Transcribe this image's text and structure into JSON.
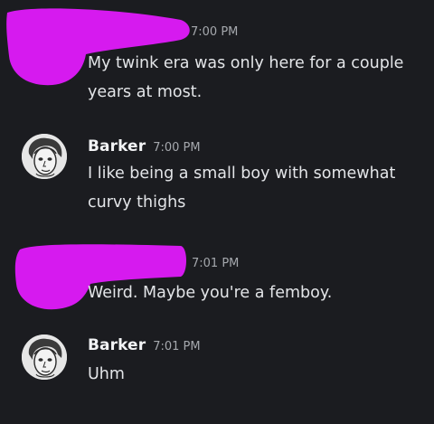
{
  "messages": [
    {
      "author": "",
      "timestamp": "7:00 PM",
      "text": "My twink era was only here for a couple years at most.",
      "redacted_author": true
    },
    {
      "author": "Barker",
      "timestamp": "7:00 PM",
      "text": "I like being a small boy with somewhat curvy thighs",
      "avatar": "cartoon-face-avatar"
    },
    {
      "author": "",
      "timestamp": "7:01 PM",
      "text": "Weird. Maybe you're a femboy.",
      "redacted_author": true
    },
    {
      "author": "Barker",
      "timestamp": "7:01 PM",
      "text": "Uhm",
      "avatar": "cartoon-face-avatar"
    }
  ],
  "colors": {
    "background": "#1b1c20",
    "redaction": "#d61aef",
    "username": "#f2f3f5",
    "timestamp": "#a5a8ad",
    "message_text": "#e3e5e8"
  }
}
